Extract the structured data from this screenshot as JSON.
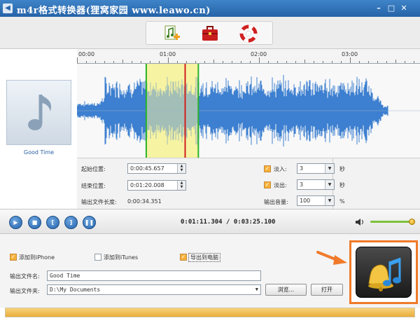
{
  "window": {
    "title": "m4r格式转换器(狸窝家园  www.leawo.cn)",
    "app_icon": "speaker-icon",
    "controls": [
      "minimize-icon",
      "maximize-icon",
      "close-icon"
    ]
  },
  "toolbar": {
    "buttons": [
      {
        "name": "add-music-button",
        "icon": "add-music-icon"
      },
      {
        "name": "toolbox-button",
        "icon": "toolbox-icon"
      },
      {
        "name": "help-button",
        "icon": "lifebuoy-icon"
      }
    ]
  },
  "track": {
    "title": "Good Time",
    "thumbnail_icon": "music-note-icon"
  },
  "timeline": {
    "labels": [
      "00:00",
      "01:00",
      "02:00",
      "03:00"
    ],
    "total_seconds": 205.1,
    "selection_start_seconds": 45.657,
    "selection_end_seconds": 80.008,
    "playhead_seconds": 71.304,
    "colors": {
      "wave": "#3d7fd0",
      "selection": "#f6f3a2",
      "marker": "#29b329",
      "playhead": "#d02020"
    }
  },
  "params": {
    "start_label": "起始位置:",
    "start_value": "0:00:45.657",
    "end_label": "结束位置:",
    "end_value": "0:01:20.008",
    "length_label": "输出文件长度:",
    "length_value": "0:00:34.351",
    "fade_in_label": "淡入:",
    "fade_in_value": "3",
    "fade_in_checked": true,
    "fade_out_label": "淡出:",
    "fade_out_value": "3",
    "fade_out_checked": true,
    "seconds_unit": "秒",
    "volume_label": "输出音量:",
    "volume_value": "100",
    "percent_unit": "%"
  },
  "transport": {
    "buttons": [
      {
        "name": "play-button",
        "icon": "play-icon"
      },
      {
        "name": "stop-button",
        "icon": "stop-icon"
      },
      {
        "name": "set-start-button",
        "icon": "bracket-left-icon"
      },
      {
        "name": "set-end-button",
        "icon": "bracket-right-icon"
      },
      {
        "name": "pause-button",
        "icon": "pause-icon"
      }
    ],
    "time": "0:01:11.304 / 0:03:25.100",
    "volume_level": 0.95
  },
  "output": {
    "add_iphone_label": "添加到iPhone",
    "add_iphone_checked": true,
    "add_itunes_label": "添加到iTunes",
    "add_itunes_checked": false,
    "export_pc_label": "导出到电脑",
    "export_pc_checked": true,
    "filename_label": "输出文件名:",
    "filename_value": "Good Time",
    "folder_label": "输出文件夹:",
    "folder_value": "D:\\My Documents",
    "browse_label": "浏览...",
    "open_label": "打开",
    "convert_icon": "bell-music-icon",
    "progress": 1.0,
    "colors": {
      "highlight": "#f07a2a",
      "progress": "#e8ad3c"
    }
  }
}
